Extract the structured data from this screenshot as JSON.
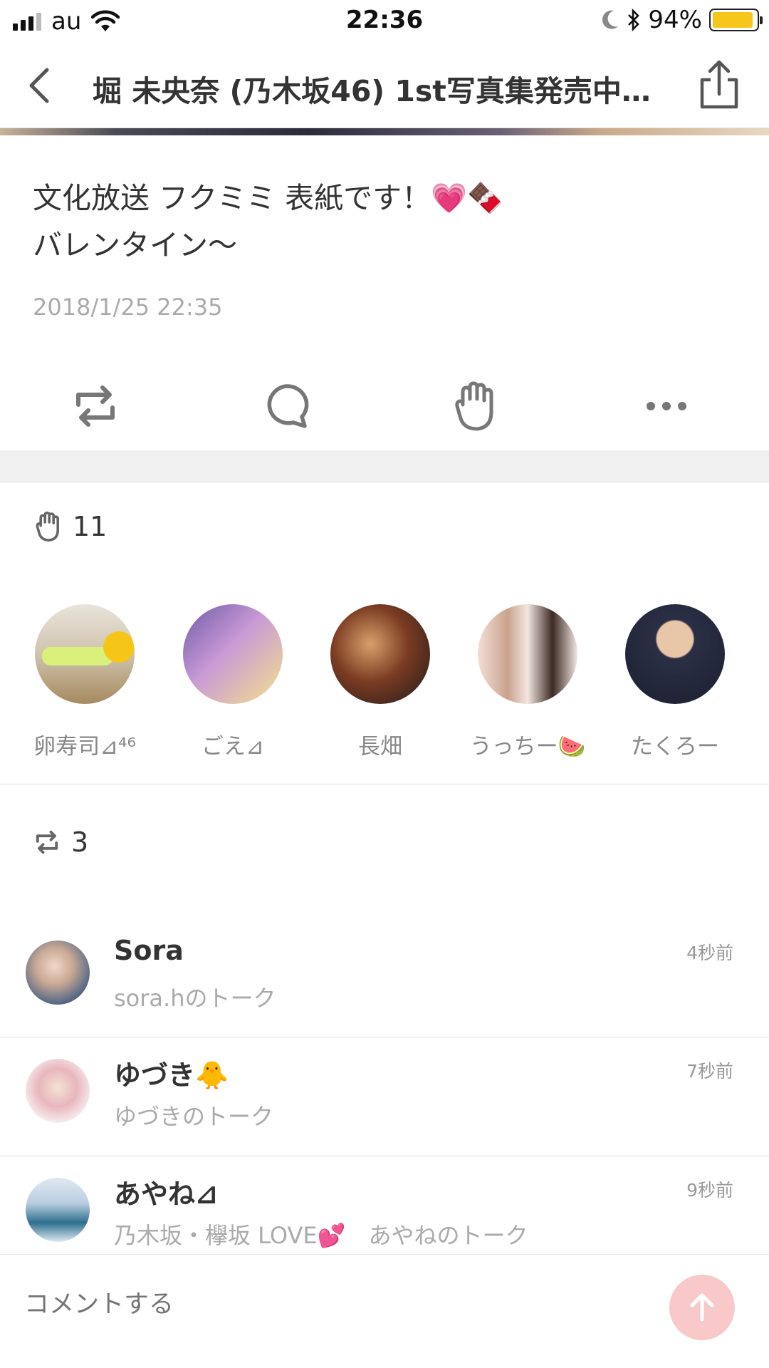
{
  "status_bar": {
    "carrier": "au",
    "time": "22:36",
    "battery": "94%",
    "battery_level": 0.94
  },
  "navbar": {
    "title": "堀 未央奈 (乃木坂46) 1st写真集発売中…"
  },
  "post": {
    "line1": "文化放送 フクミミ 表紙です！💗🍫",
    "line2": "バレンタイン〜",
    "date": "2018/1/25 22:35"
  },
  "likes": {
    "count": "11"
  },
  "likers": [
    {
      "name": "卵寿司⊿⁴⁶",
      "avatar_color": "#a58a5e"
    },
    {
      "name": "ごえ⊿",
      "avatar_color": "#b987c9"
    },
    {
      "name": "長畑",
      "avatar_color": "#5a3a2a"
    },
    {
      "name": "うっちー🍉",
      "avatar_color": "#e8d2cf"
    },
    {
      "name": "たくろー",
      "avatar_color": "#2b2f45"
    }
  ],
  "retweets": {
    "count": "3"
  },
  "users": [
    {
      "name": "Sora",
      "sub": "sora.hのトーク",
      "time": "4秒前",
      "avatar_color": "#7c8a9e"
    },
    {
      "name": "ゆづき🐥",
      "sub": "ゆづきのトーク",
      "time": "7秒前",
      "avatar_color": "#e6b3b8"
    },
    {
      "name": "あやね⊿",
      "sub": "乃木坂・欅坂 LOVE💕　あやねのトーク",
      "time": "9秒前",
      "avatar_color": "#8fa9c4"
    }
  ],
  "comment": {
    "placeholder": "コメントする"
  },
  "colors": {
    "accent": "#f9c8c8",
    "battery": "#f7c61b"
  }
}
